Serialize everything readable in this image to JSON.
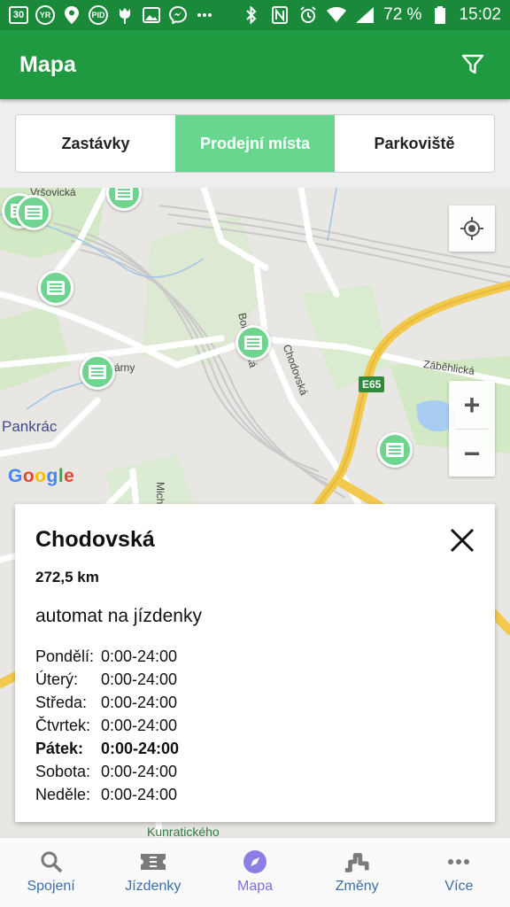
{
  "status_bar": {
    "left_icons": [
      "calendar-30-icon",
      "yr-icon",
      "location-pin-icon",
      "pid-icon",
      "tulip-icon",
      "image-icon",
      "messenger-icon",
      "more-dots-icon"
    ],
    "calendar_day": "30",
    "yr_label": "YR",
    "pid_label": "PID",
    "right_icons": [
      "bluetooth-icon",
      "nfc-icon",
      "alarm-icon",
      "wifi-icon",
      "signal-icon",
      "battery-icon"
    ],
    "battery": "72 %",
    "time": "15:02"
  },
  "app_bar": {
    "title": "Mapa",
    "filter_icon": "filter-icon"
  },
  "tabs": [
    {
      "label": "Zastávky",
      "active": false
    },
    {
      "label": "Prodejní místa",
      "active": true
    },
    {
      "label": "Parkoviště",
      "active": false
    }
  ],
  "map": {
    "labels": {
      "vrsovicka": "Vršovická",
      "bohdalecka": "Bohdalecká",
      "chodovska": "Chodovská",
      "zabehlicka": "Záběhlická",
      "jarny": "árny",
      "pankrac": "Pankrác",
      "e65": "E65",
      "michle": "Mich",
      "kunraticke": "Kunratického"
    },
    "google": [
      "G",
      "o",
      "o",
      "g",
      "l",
      "e"
    ],
    "zoom_in": "+",
    "zoom_out": "−"
  },
  "card": {
    "title": "Chodovská",
    "distance": "272,5 km",
    "type": "automat na jízdenky",
    "hours": [
      {
        "day": "Pondělí:",
        "time": "0:00-24:00"
      },
      {
        "day": "Úterý:",
        "time": "0:00-24:00"
      },
      {
        "day": "Středa:",
        "time": "0:00-24:00"
      },
      {
        "day": "Čtvrtek:",
        "time": "0:00-24:00"
      },
      {
        "day": "Pátek:",
        "time": "0:00-24:00"
      },
      {
        "day": "Sobota:",
        "time": "0:00-24:00"
      },
      {
        "day": "Neděle:",
        "time": "0:00-24:00"
      }
    ],
    "today_index": 4
  },
  "bottom_nav": [
    {
      "label": "Spojení",
      "icon": "search-icon"
    },
    {
      "label": "Jízdenky",
      "icon": "ticket-icon"
    },
    {
      "label": "Mapa",
      "icon": "compass-icon",
      "active": true
    },
    {
      "label": "Změny",
      "icon": "changes-icon"
    },
    {
      "label": "Více",
      "icon": "more-icon"
    }
  ],
  "colors": {
    "status_bar": "#1a8a3a",
    "app_bar": "#1f9a40",
    "tab_active": "#69d68f",
    "marker": "#6fd48f",
    "nav_text": "#3a6ea5",
    "nav_active": "#7a6fe0"
  }
}
